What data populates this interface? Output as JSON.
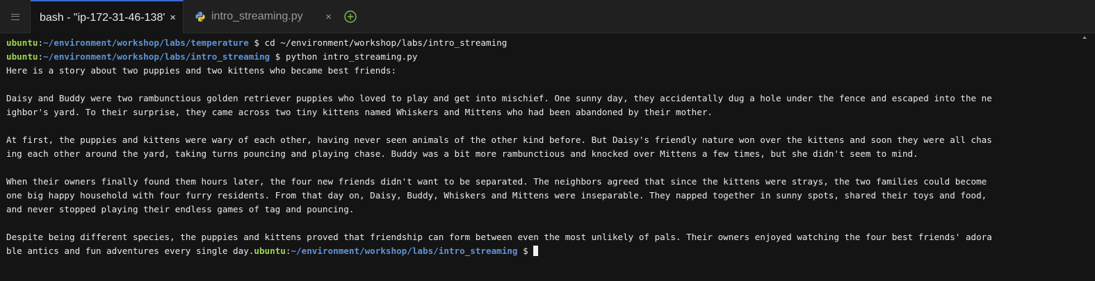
{
  "tabs": [
    {
      "label": "bash - \"ip-172-31-46-138'",
      "active": true,
      "close": "×"
    },
    {
      "label": "intro_streaming.py",
      "active": false,
      "close": "×",
      "icon": "python-icon"
    }
  ],
  "add_tab_icon": "plus-circle-icon",
  "colors": {
    "prompt_user": "#9bd64c",
    "prompt_path": "#5e93d8",
    "background": "#141414",
    "active_tab_accent": "#3d6ad6"
  },
  "terminal": {
    "prompt1": {
      "user": "ubuntu",
      "sep": ":",
      "path": "~/environment/workshop/labs/temperature",
      "symbol": " $ ",
      "command": "cd ~/environment/workshop/labs/intro_streaming"
    },
    "prompt2": {
      "user": "ubuntu",
      "sep": ":",
      "path": "~/environment/workshop/labs/intro_streaming",
      "symbol": " $ ",
      "command": "python intro_streaming.py"
    },
    "output": [
      "Here is a story about two puppies and two kittens who became best friends:",
      "",
      "Daisy and Buddy were two rambunctious golden retriever puppies who loved to play and get into mischief. One sunny day, they accidentally dug a hole under the fence and escaped into the ne",
      "ighbor's yard. To their surprise, they came across two tiny kittens named Whiskers and Mittens who had been abandoned by their mother.",
      "",
      "At first, the puppies and kittens were wary of each other, having never seen animals of the other kind before. But Daisy's friendly nature won over the kittens and soon they were all chas",
      "ing each other around the yard, taking turns pouncing and playing chase. Buddy was a bit more rambunctious and knocked over Mittens a few times, but she didn't seem to mind.",
      "",
      "When their owners finally found them hours later, the four new friends didn't want to be separated. The neighbors agreed that since the kittens were strays, the two families could become",
      "one big happy household with four furry residents. From that day on, Daisy, Buddy, Whiskers and Mittens were inseparable. They napped together in sunny spots, shared their toys and food,",
      "and never stopped playing their endless games of tag and pouncing.",
      "",
      "Despite being different species, the puppies and kittens proved that friendship can form between even the most unlikely of pals. Their owners enjoyed watching the four best friends' adora"
    ],
    "last_line": {
      "text": "ble antics and fun adventures every single day.",
      "user": "ubuntu",
      "sep": ":",
      "path": "~/environment/workshop/labs/intro_streaming",
      "symbol": " $ "
    }
  }
}
